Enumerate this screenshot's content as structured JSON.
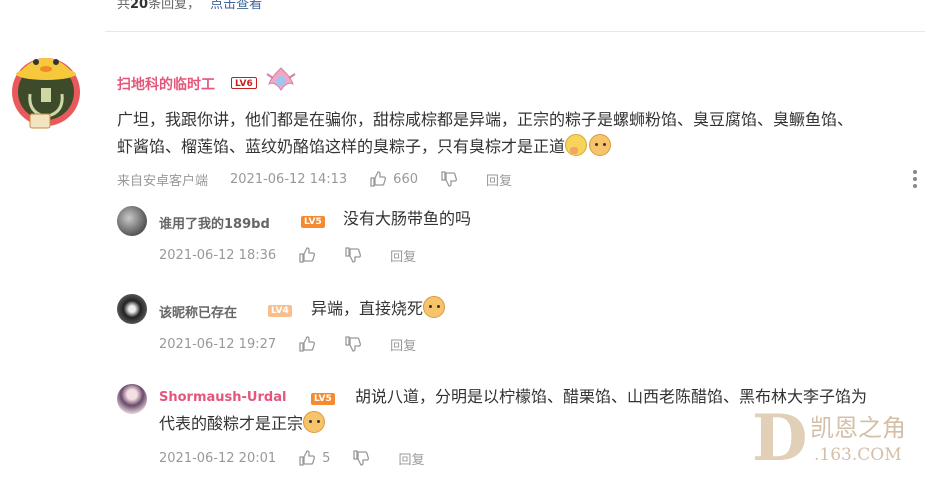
{
  "header": {
    "reply_prefix": "共",
    "reply_count": "20",
    "reply_suffix": "条回复，",
    "view_link": "点击查看"
  },
  "main_comment": {
    "username": "扫地科的临时工",
    "level": "LV6",
    "text_line1": "广坦，我跟你讲，他们都是在骗你，甜棕咸棕都是异端，正宗的粽子是螺蛳粉馅、臭豆腐馅、臭鳜鱼馅、",
    "text_line2": "虾酱馅、榴莲馅、蓝纹奶酪馅这样的臭粽子，只有臭棕才是正道",
    "source": "来自安卓客户端",
    "time": "2021-06-12 14:13",
    "likes": "660",
    "reply_label": "回复"
  },
  "sub_comments": [
    {
      "username": "谁用了我的189bd",
      "level": "LV5",
      "text": "没有大肠带鱼的吗",
      "time": "2021-06-12 18:36",
      "likes": "",
      "reply_label": "回复"
    },
    {
      "username": "该昵称已存在",
      "level": "LV4",
      "text": "异端，直接烧死",
      "time": "2021-06-12 19:27",
      "likes": "",
      "reply_label": "回复"
    },
    {
      "username": "Shormaush-Urdal",
      "level": "LV5",
      "text_line1": "胡说八道，分明是以柠檬馅、醋栗馅、山西老陈醋馅、黑布林大李子馅为",
      "text_line2": "代表的酸粽才是正宗",
      "time": "2021-06-12 20:01",
      "likes": "5",
      "reply_label": "回复"
    }
  ],
  "watermark": {
    "line1": "凯恩之角",
    "line2": ".163.COM"
  },
  "colors": {
    "username_pink": "#e4577b",
    "meta_gray": "#999999",
    "link_blue": "#406599"
  }
}
